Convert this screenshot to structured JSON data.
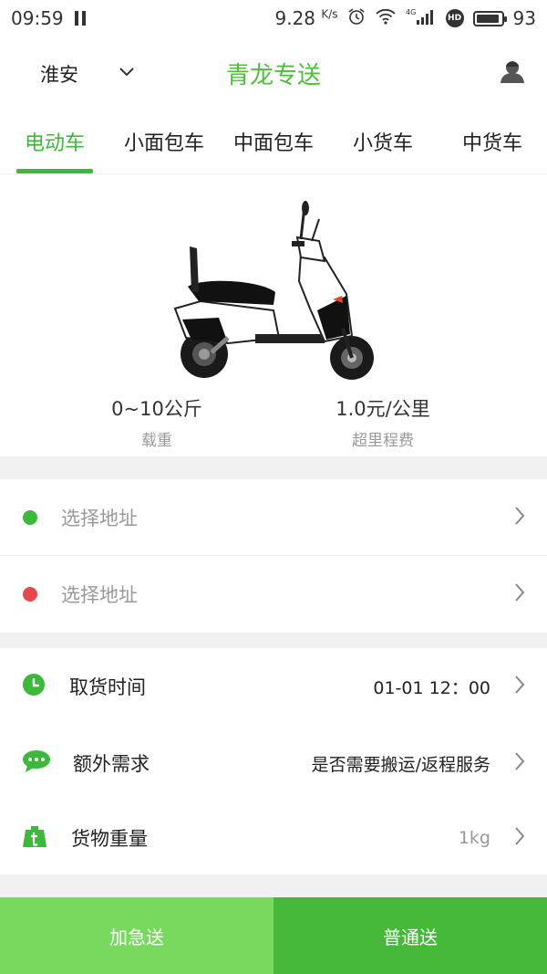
{
  "status_bar": {
    "time": "09:59",
    "speed": "9.28",
    "speed_unit": "K/s",
    "network": "4G",
    "hd_badge": "HD",
    "battery_level": "93",
    "battery_fraction": 0.93
  },
  "header": {
    "city": "淮安",
    "title": "青龙专送"
  },
  "tabs": [
    {
      "label": "电动车",
      "active": true
    },
    {
      "label": "小面包车",
      "active": false
    },
    {
      "label": "中面包车",
      "active": false
    },
    {
      "label": "小货车",
      "active": false
    },
    {
      "label": "中货车",
      "active": false
    }
  ],
  "vehicle": {
    "load_value": "0~10公斤",
    "load_label": "载重",
    "fee_value": "1.0元/公里",
    "fee_label": "超里程费"
  },
  "addresses": {
    "pickup_placeholder": "选择地址",
    "dropoff_placeholder": "选择地址"
  },
  "options": {
    "pickup_time_label": "取货时间",
    "pickup_time_value": "01-01 12：00",
    "extra_label": "额外需求",
    "extra_value": "是否需要搬运/返程服务",
    "weight_label": "货物重量",
    "weight_value": "1kg"
  },
  "actions": {
    "urgent_label": "加急送",
    "normal_label": "普通送"
  },
  "colors": {
    "brand_green": "#3cb83a",
    "pickup_dot": "#3cb83a",
    "dropoff_dot": "#e5484d",
    "urgent_button": "#77d95e",
    "normal_button": "#46b93a"
  }
}
